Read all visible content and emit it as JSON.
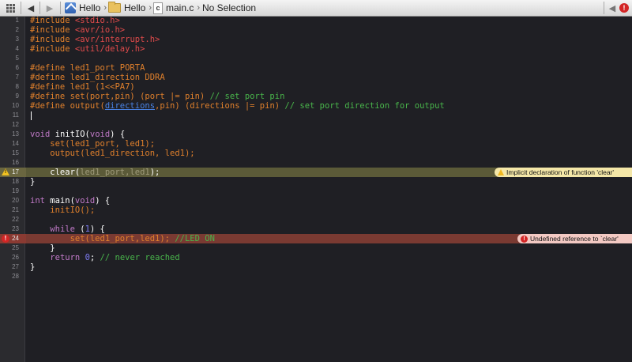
{
  "jumpbar": {
    "project": "Hello",
    "group": "Hello",
    "file": "main.c",
    "selection": "No Selection",
    "file_icon_glyph": "c",
    "error_badge_glyph": "!",
    "chevron": "›",
    "back_arrow": "◀",
    "forward_arrow": "▶",
    "issue_prev": "◀"
  },
  "gutter": {
    "line_numbers": [
      "1",
      "2",
      "3",
      "4",
      "5",
      "6",
      "7",
      "8",
      "9",
      "10",
      "11",
      "12",
      "13",
      "14",
      "15",
      "16",
      "17",
      "18",
      "19",
      "20",
      "21",
      "22",
      "23",
      "24",
      "25",
      "26",
      "27",
      "28"
    ],
    "warning_line": "17",
    "error_line": "24"
  },
  "code": {
    "l1": [
      "#include ",
      "<stdio.h>"
    ],
    "l2": [
      "#include ",
      "<avr/io.h>"
    ],
    "l3": [
      "#include ",
      "<avr/interrupt.h>"
    ],
    "l4": [
      "#include ",
      "<util/delay.h>"
    ],
    "l6": "#define led1_port PORTA",
    "l7": "#define led1_direction DDRA",
    "l8": "#define led1 (1<<PA7)",
    "l9": [
      "#define set(port,pin) (port |= pin) ",
      "// set port pin"
    ],
    "l10": [
      "#define output(",
      "directions",
      ",pin) (directions |= pin) ",
      "// set port direction for output"
    ],
    "l13": [
      "void",
      " initIO(",
      "void",
      ") {"
    ],
    "l14": "    set(led1_port, led1);",
    "l15": "    output(led1_direction, led1);",
    "l17": [
      "    clear(",
      "led1_port,led1",
      ");"
    ],
    "l18": "}",
    "l20": [
      "int",
      " main(",
      "void",
      ") {"
    ],
    "l21": "    initIO();",
    "l23": [
      "    ",
      "while",
      " (",
      "1",
      ") {"
    ],
    "l24": [
      "        set(led1_port,led1); ",
      "//LED ON"
    ],
    "l25": "    }",
    "l26": [
      "    ",
      "return",
      " ",
      "0",
      "; ",
      "// never reached"
    ],
    "l27": "}"
  },
  "issues": {
    "warning": "Implicit declaration of function 'clear'",
    "error": "Undefined reference to `clear'"
  },
  "colors": {
    "editor_background": "#1f1f24",
    "preprocessor": "#e0802c",
    "string": "#e04b4b",
    "keyword": "#c27ac9",
    "comment": "#49b64b",
    "number": "#7d7bf2",
    "warning_line_bg": "#5b5a38",
    "error_line_bg": "#7a3a32"
  },
  "icons": {
    "grid": "grid-icon",
    "project": "xcode-project-icon",
    "group": "folder-icon",
    "file": "c-source-file-icon",
    "warning": "warning-triangle-icon",
    "error": "error-circle-icon"
  }
}
